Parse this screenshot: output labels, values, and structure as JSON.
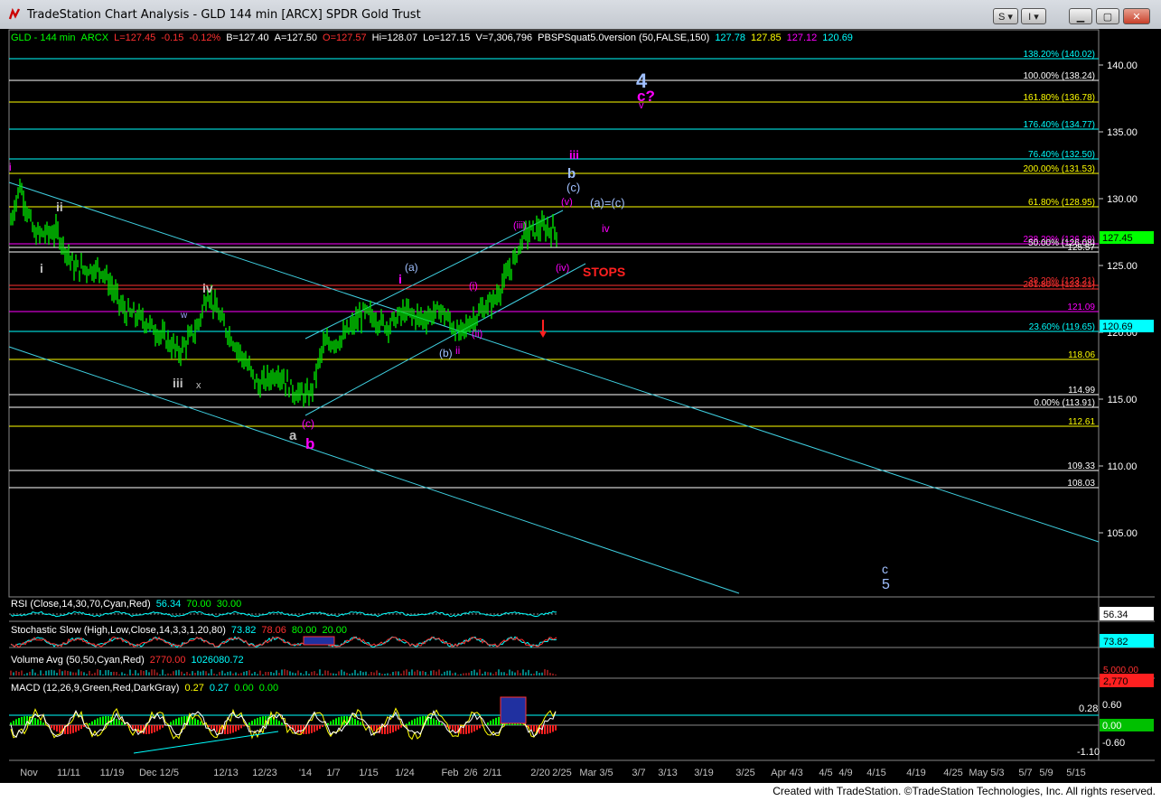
{
  "window": {
    "title": "TradeStation Chart Analysis - GLD 144 min [ARCX] SPDR Gold Trust",
    "buttons": [
      "S",
      "I"
    ]
  },
  "header": {
    "items": [
      {
        "text": "GLD - 144 min",
        "color": "#00ff00"
      },
      {
        "text": "ARCX",
        "color": "#00ff00"
      },
      {
        "text": "L=127.45",
        "color": "#ff3030"
      },
      {
        "text": "-0.15",
        "color": "#ff3030"
      },
      {
        "text": "-0.12%",
        "color": "#ff3030"
      },
      {
        "text": "B=127.40",
        "color": "#ffffff"
      },
      {
        "text": "A=127.50",
        "color": "#ffffff"
      },
      {
        "text": "O=127.57",
        "color": "#ff3030"
      },
      {
        "text": "Hi=128.07",
        "color": "#ffffff"
      },
      {
        "text": "Lo=127.15",
        "color": "#ffffff"
      },
      {
        "text": "V=7,306,796",
        "color": "#ffffff"
      },
      {
        "text": "PBSPSquat5.0version (50,FALSE,150)",
        "color": "#ffffff"
      },
      {
        "text": "127.78",
        "color": "#00ffff"
      },
      {
        "text": "127.85",
        "color": "#ffff00"
      },
      {
        "text": "127.12",
        "color": "#ff00ff"
      },
      {
        "text": "120.69",
        "color": "#00ffff"
      }
    ]
  },
  "price_axis": {
    "ticks": [
      "140.00",
      "135.00",
      "130.00",
      "125.00",
      "120.00",
      "115.00",
      "110.00",
      "105.00"
    ],
    "badges": [
      {
        "text": "127.45",
        "color": "#00ff00",
        "fg": "#000000"
      },
      {
        "text": "120.69",
        "color": "#00ffff",
        "fg": "#000000"
      }
    ]
  },
  "levels": [
    {
      "label": "138.20% (140.02)",
      "color": "#00ffff"
    },
    {
      "label": "100.00% (138.24)",
      "color": "#ffffff"
    },
    {
      "label": "161.80% (136.78)",
      "color": "#ffff00"
    },
    {
      "label": "176.40% (134.77)",
      "color": "#00ffff"
    },
    {
      "label": "76.40% (132.50)",
      "color": "#00ffff"
    },
    {
      "label": "200.00% (131.53)",
      "color": "#ffff00"
    },
    {
      "label": "61.80% (128.95)",
      "color": "#ffff00"
    },
    {
      "label": "238.20% (126.28)",
      "color": "#ff00ff"
    },
    {
      "label": "50.00% (126.08)",
      "color": "#ffffff"
    },
    {
      "label": "125.57",
      "color": "#ffffff"
    },
    {
      "label": "38.20% (123.21)",
      "color": "#ff3030"
    },
    {
      "label": "261.80% (123.21)",
      "color": "#ff3030"
    },
    {
      "label": "121.09",
      "color": "#ff00ff"
    },
    {
      "label": "23.60% (119.65)",
      "color": "#00ffff"
    },
    {
      "label": "118.06",
      "color": "#ffff00"
    },
    {
      "label": "114.99",
      "color": "#ffffff"
    },
    {
      "label": "0.00% (113.91)",
      "color": "#ffffff"
    },
    {
      "label": "112.61",
      "color": "#ffff00"
    },
    {
      "label": "109.33",
      "color": "#ffffff"
    },
    {
      "label": "108.03",
      "color": "#ffffff"
    }
  ],
  "wave_labels": [
    "i",
    "ii",
    "i",
    "iv",
    "w",
    "iii",
    "x",
    "a",
    "(c)",
    "b",
    "(a)",
    "i",
    "(b)",
    "ii",
    "(i)",
    "(ii)",
    "(iii)",
    "(iv)",
    "(v)",
    "iii",
    "b",
    "(c)",
    "(a)=(c)",
    "iv",
    "STOPS",
    "4",
    "c?",
    "v",
    "c",
    "5"
  ],
  "indicators": {
    "rsi": {
      "label": "RSI (Close,14,30,70,Cyan,Red)",
      "v1": "56.34",
      "v2": "70.00",
      "v3": "30.00",
      "badge": "56.34"
    },
    "stoch": {
      "label": "Stochastic Slow (High,Low,Close,14,3,3,1,20,80)",
      "v1": "73.82",
      "v2": "78.06",
      "v3": "80.00",
      "v4": "20.00",
      "badge": "73.82"
    },
    "volume": {
      "label": "Volume Avg (50,50,Cyan,Red)",
      "v1": "2770.00",
      "v2": "1026080.72",
      "badge1": "5,000.00",
      "badge2": "2,770"
    },
    "macd": {
      "label": "MACD (12,26,9,Green,Red,DarkGray)",
      "v1": "0.27",
      "v2": "0.27",
      "v3": "0.00",
      "v4": "0.00",
      "ticks": [
        "0.60",
        "0.28",
        "0.00",
        "-0.60",
        "-1.10"
      ]
    }
  },
  "date_axis": [
    "Nov",
    "11/11",
    "11/19",
    "Dec 12/5",
    "12/13",
    "12/23",
    "'14",
    "1/7",
    "1/15",
    "1/24",
    "Feb",
    "2/6",
    "2/11",
    "2/20",
    "2/25",
    "Mar 3/5",
    "3/7",
    "3/13",
    "3/19",
    "3/25",
    "Apr 4/3",
    "4/5",
    "4/9",
    "4/15",
    "4/19",
    "4/25",
    "May 5/3",
    "5/7",
    "5/9",
    "5/15"
  ],
  "footer": {
    "credit": "Created with TradeStation. ©TradeStation Technologies, Inc. All rights reserved."
  }
}
